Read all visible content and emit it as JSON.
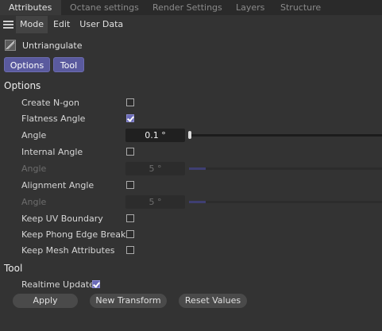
{
  "tabs": [
    {
      "label": "Attributes",
      "active": true
    },
    {
      "label": "Octane settings",
      "active": false
    },
    {
      "label": "Render Settings",
      "active": false
    },
    {
      "label": "Layers",
      "active": false
    },
    {
      "label": "Structure",
      "active": false
    }
  ],
  "menubar": {
    "menu_icon": "hamburger-menu-icon",
    "items": [
      "Mode",
      "Edit",
      "User Data"
    ],
    "active": "Mode"
  },
  "object": {
    "icon": "untriangulate-icon",
    "name": "Untriangulate"
  },
  "mode_buttons": {
    "options_label": "Options",
    "tool_label": "Tool"
  },
  "options_section": {
    "title": "Options",
    "create_ngon": {
      "label": "Create N-gon",
      "checked": false
    },
    "flatness_angle": {
      "label": "Flatness Angle",
      "checked": true
    },
    "angle": {
      "label": "Angle",
      "value": "0.1 °",
      "slider_fraction": 0.0
    },
    "internal_angle": {
      "label": "Internal Angle",
      "checked": false
    },
    "internal_angle_value": {
      "label": "Angle",
      "value": "5 °",
      "disabled": true
    },
    "alignment_angle": {
      "label": "Alignment Angle",
      "checked": false
    },
    "alignment_angle_value": {
      "label": "Angle",
      "value": "5 °",
      "disabled": true
    },
    "keep_uv_boundary": {
      "label": "Keep UV Boundary",
      "checked": false
    },
    "keep_phong_edge_breaks": {
      "label": "Keep Phong Edge Breaks",
      "checked": false
    },
    "keep_mesh_attributes": {
      "label": "Keep Mesh Attributes",
      "checked": false
    }
  },
  "tool_section": {
    "title": "Tool",
    "realtime_update": {
      "label": "Realtime Update",
      "checked": true
    },
    "apply_label": "Apply",
    "new_transform_label": "New Transform",
    "reset_values_label": "Reset Values"
  },
  "colors": {
    "panel_bg": "#333333",
    "accent": "#5a5a9e",
    "checkbox_checked": "#6a6ab8"
  }
}
